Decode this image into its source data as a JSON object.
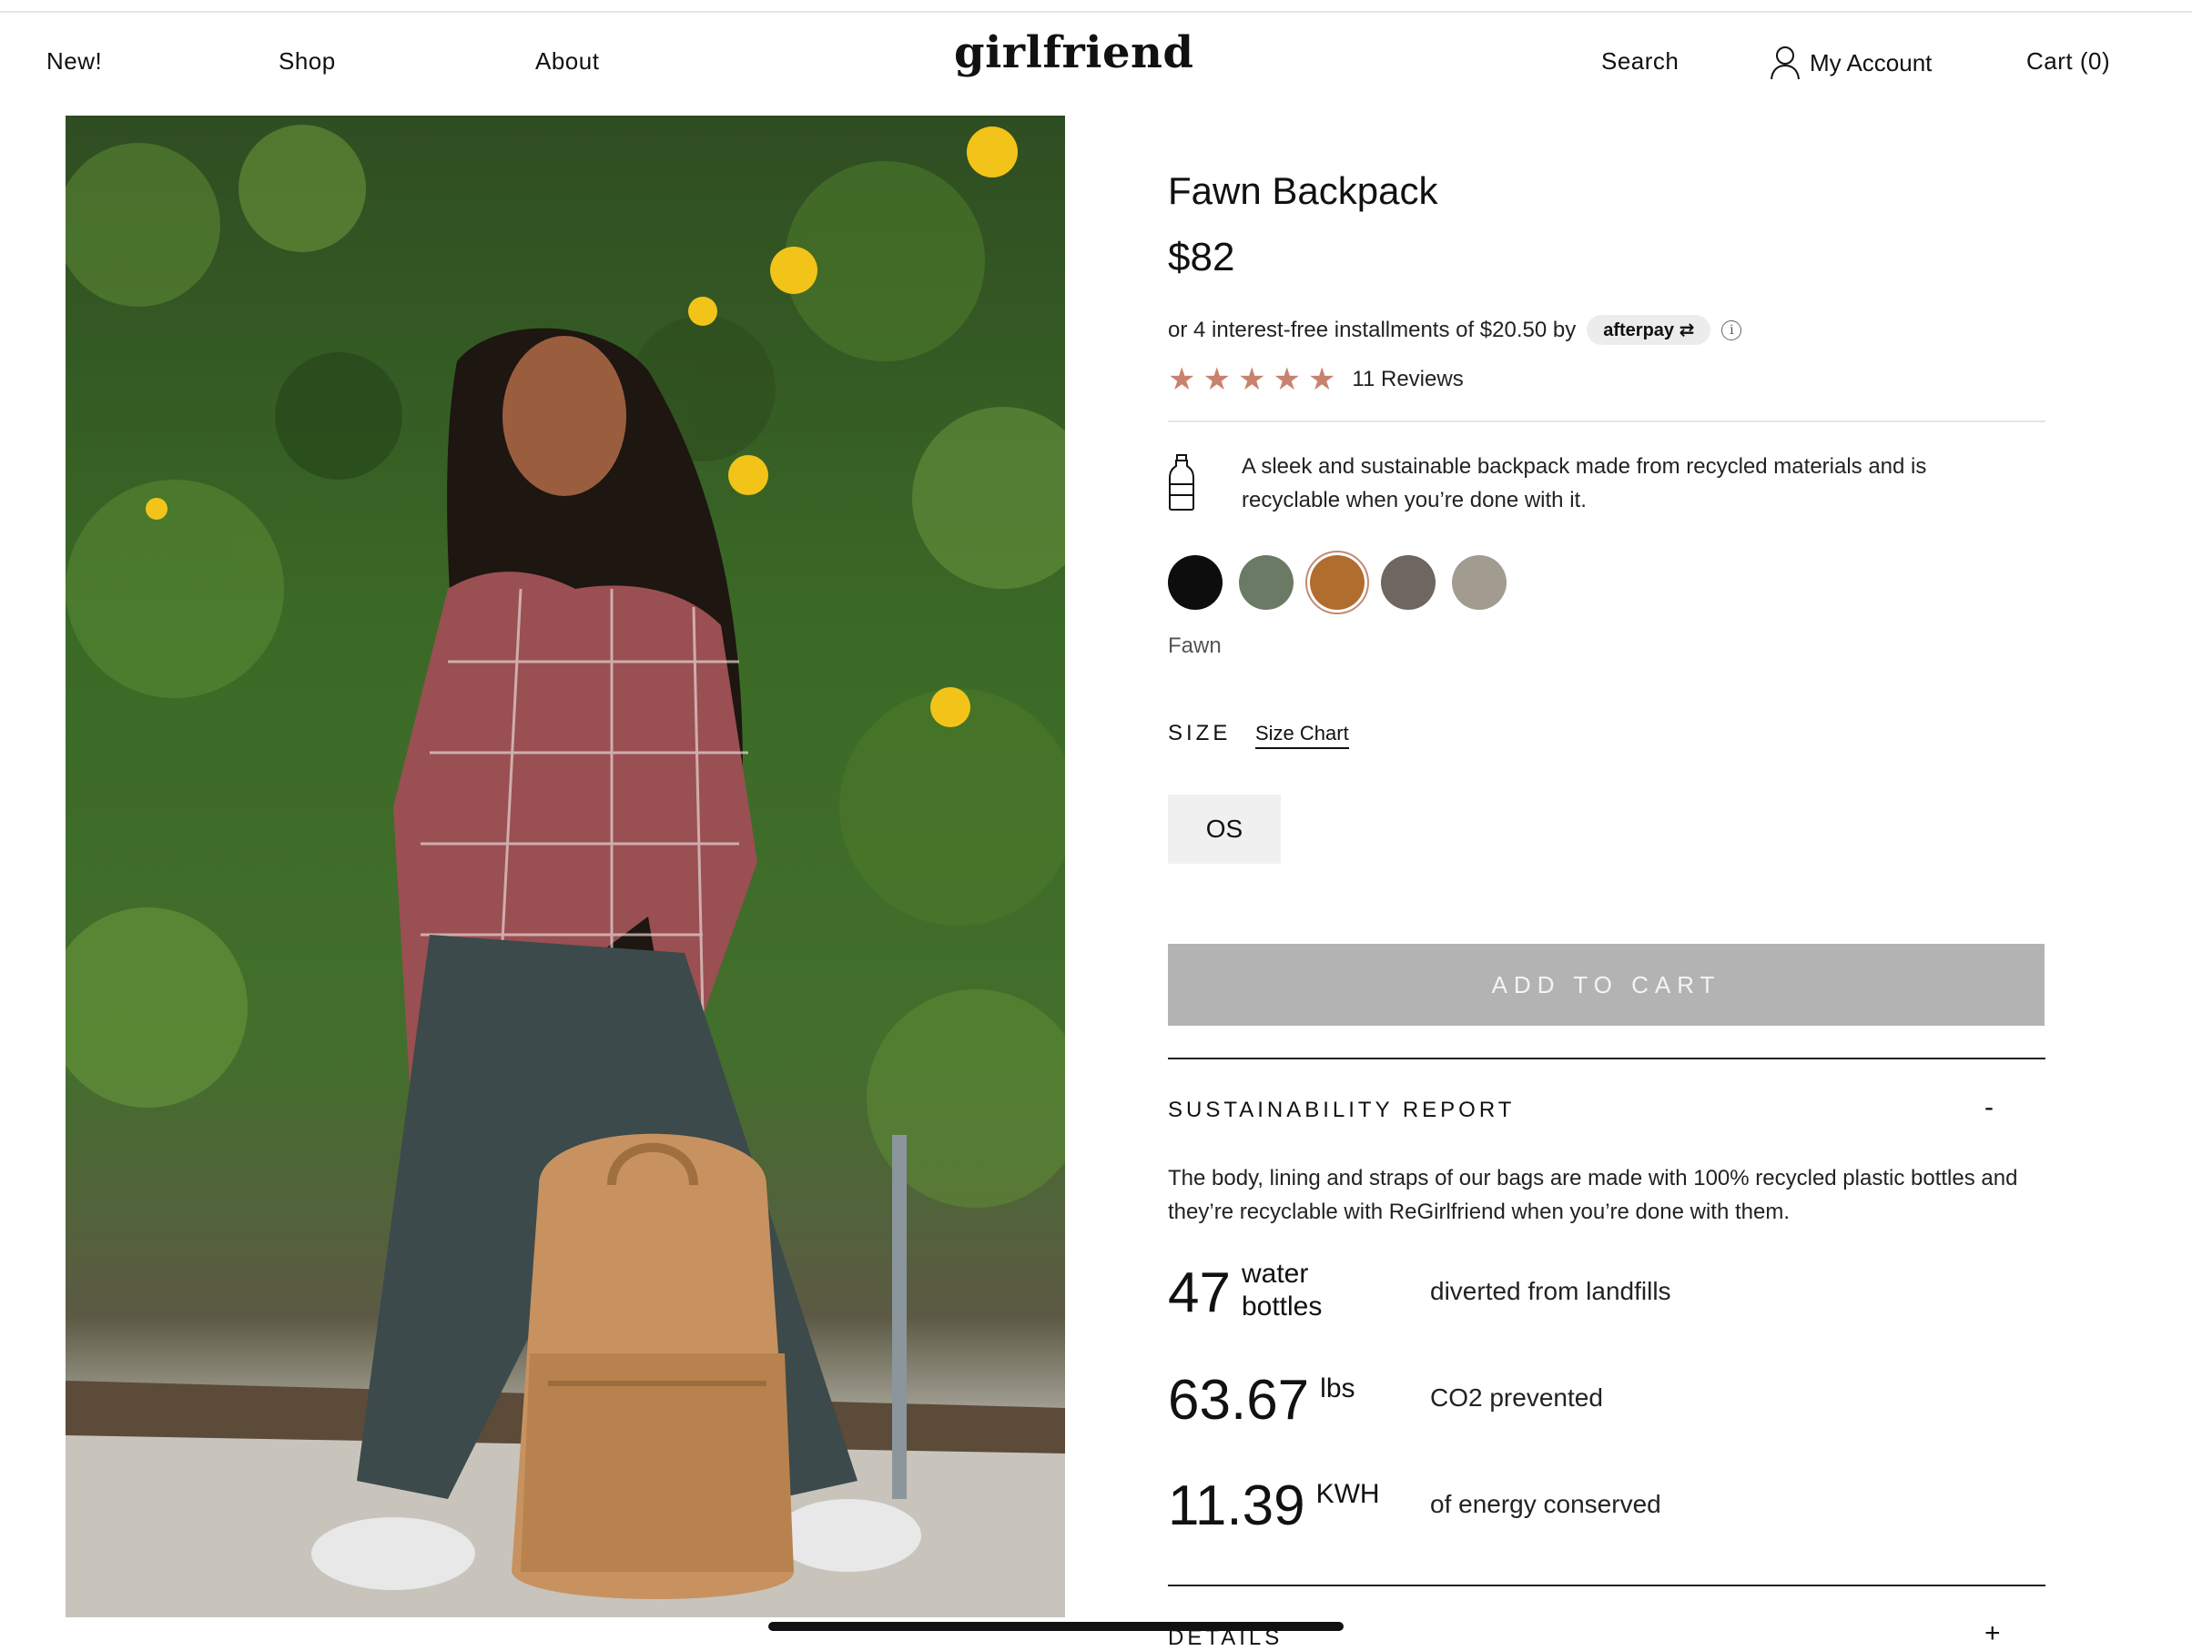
{
  "header": {
    "nav": [
      "New!",
      "Shop",
      "About"
    ],
    "logo": "girlfriend",
    "search": "Search",
    "account": "My Account",
    "cart": "Cart (0)"
  },
  "product": {
    "title": "Fawn Backpack",
    "price": "$82",
    "installments_text": "or 4 interest-free installments of $20.50 by",
    "afterpay_label": "afterpay",
    "info_symbol": "i",
    "stars": 5,
    "reviews": "11 Reviews",
    "description": "A sleek and sustainable backpack made from recycled materials and is recyclable when you’re done with it.",
    "colors": [
      {
        "hex": "#0d0d0d"
      },
      {
        "hex": "#6b7a64"
      },
      {
        "hex": "#b16d2d",
        "selected": true
      },
      {
        "hex": "#6e6660"
      },
      {
        "hex": "#a19b90"
      }
    ],
    "selected_color": "Fawn",
    "size_label": "SIZE",
    "size_chart": "Size Chart",
    "size_option": "OS",
    "add_to_cart": "ADD TO CART"
  },
  "sustainability": {
    "title": "SUSTAINABILITY REPORT",
    "toggle": "-",
    "body": "The body, lining and straps of our bags are made with 100% recycled plastic bottles and they’re recyclable with ReGirlfriend when you’re done with them.",
    "stats": [
      {
        "value": "47",
        "unit_line1": "water",
        "unit_line2": "bottles",
        "desc": "diverted from landfills"
      },
      {
        "value": "63.67",
        "unit": "lbs",
        "desc": "CO2 prevented"
      },
      {
        "value": "11.39",
        "unit": "KWH",
        "desc": "of energy conserved"
      }
    ]
  },
  "details": {
    "title": "DETAILS",
    "toggle": "+"
  },
  "colors": {
    "star": "#c9826d",
    "button_bg": "#b3b3b3"
  }
}
